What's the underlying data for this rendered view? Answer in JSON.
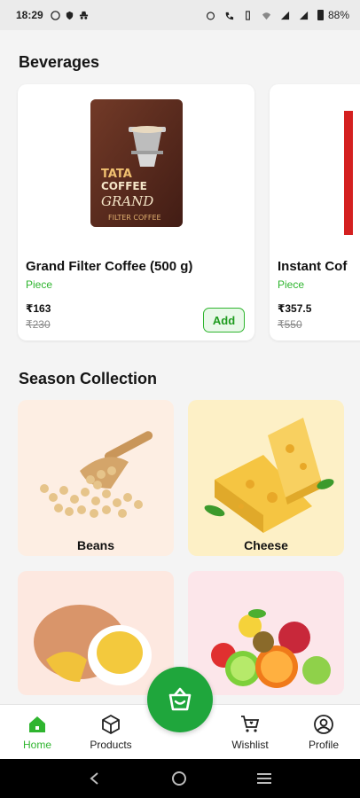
{
  "status_bar": {
    "time": "18:29",
    "battery": "88%"
  },
  "sections": {
    "beverages": "Beverages",
    "season": "Season Collection"
  },
  "products": [
    {
      "name": "Grand Filter Coffee (500 g)",
      "unit": "Piece",
      "price": "₹163",
      "mrp": "₹230",
      "add_label": "Add"
    },
    {
      "name": "Instant Cof",
      "unit": "Piece",
      "price": "₹357.5",
      "mrp": "₹550"
    }
  ],
  "coffee_pack": {
    "line1": "TATA",
    "line2": "COFFEE",
    "line3": "GRAND",
    "line4": "FILTER COFFEE"
  },
  "collections": [
    {
      "label": "Beans"
    },
    {
      "label": "Cheese"
    },
    {
      "label": ""
    },
    {
      "label": ""
    }
  ],
  "nav": {
    "home": "Home",
    "products": "Products",
    "wishlist": "Wishlist",
    "profile": "Profile"
  },
  "colors": {
    "accent": "#2fb52f",
    "fab": "#1fa63c"
  },
  "icons": {
    "home": "home-icon",
    "products": "box-icon",
    "cart": "basket-icon",
    "wishlist": "cart-heart-icon",
    "profile": "user-icon"
  }
}
